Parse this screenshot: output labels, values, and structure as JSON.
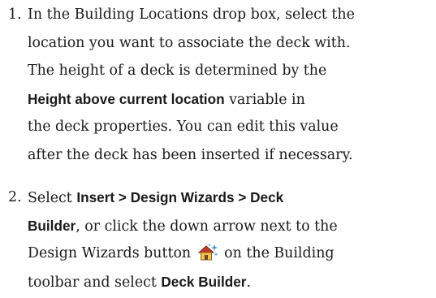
{
  "steps": [
    {
      "number": "1.",
      "lines": [
        {
          "segments": [
            {
              "text": "In the Building Locations drop box, select the"
            }
          ]
        },
        {
          "segments": [
            {
              "text": "location you want to associate the deck with."
            }
          ]
        },
        {
          "segments": [
            {
              "text": "The height of a deck is determined by the"
            }
          ]
        },
        {
          "segments": [
            {
              "text": "Height above current location",
              "bold": true
            },
            {
              "text": " variable in"
            }
          ]
        },
        {
          "segments": [
            {
              "text": "the deck properties. You can edit this value"
            }
          ]
        },
        {
          "segments": [
            {
              "text": "after the deck has been inserted if necessary."
            }
          ]
        }
      ]
    },
    {
      "number": "2.",
      "lines": [
        {
          "segments": [
            {
              "text": "Select "
            },
            {
              "text": "Insert > Design Wizards > Deck",
              "bold": true
            }
          ]
        },
        {
          "segments": [
            {
              "text": "Builder",
              "bold": true
            },
            {
              "text": ", or click the down arrow next to the"
            }
          ]
        },
        {
          "segments": [
            {
              "text": "Design Wizards button "
            },
            {
              "icon": "design-wizards-icon"
            },
            {
              "text": " on the Building"
            }
          ]
        },
        {
          "segments": [
            {
              "text": "toolbar and select "
            },
            {
              "text": "Deck Builder",
              "bold": true
            },
            {
              "text": "."
            }
          ]
        }
      ]
    }
  ],
  "colors": {
    "text": "#1a1a1a",
    "house_roof": "#c0392b",
    "house_wall": "#f2c14e",
    "sparkle": "#3b8fd6"
  }
}
